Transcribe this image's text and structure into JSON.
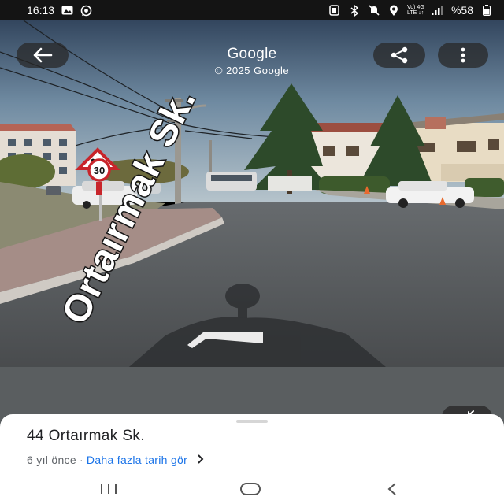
{
  "status_bar": {
    "time": "16:13",
    "network": "Vo) 4G\nLTE ↓↑",
    "battery": "%58",
    "icons": [
      "gallery-icon",
      "whatsapp-icon",
      "nfc-icon",
      "bluetooth-icon",
      "mute-icon",
      "location-icon",
      "signal-icon",
      "battery-icon"
    ]
  },
  "header": {
    "title": "Google",
    "subtitle": "© 2025 Google"
  },
  "scene": {
    "street_label": "Ortaırmak Sk.",
    "sign_speed": "30"
  },
  "card": {
    "address": "44 Ortaırmak Sk.",
    "date": "6 yıl önce",
    "separator": "·",
    "more_dates_link": "Daha fazla tarih gör",
    "link_color": "#1a73e8"
  },
  "nav": {
    "recents": "recents-icon",
    "home": "home-icon",
    "back": "back-icon"
  }
}
